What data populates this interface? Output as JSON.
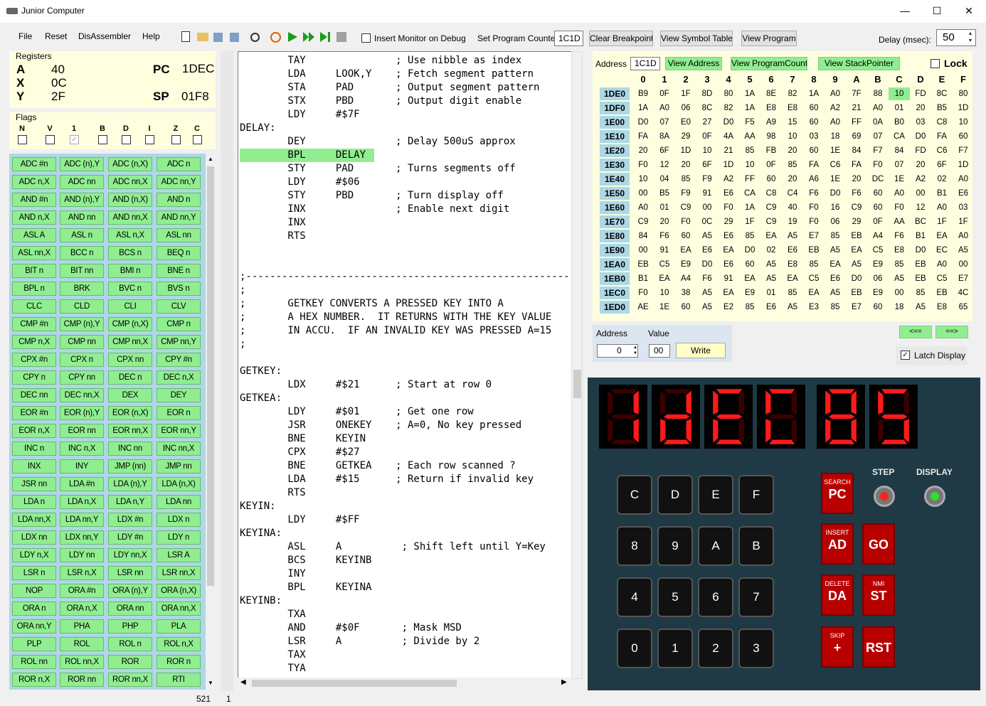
{
  "window": {
    "title": "Junior Computer",
    "min": "—",
    "max": "☐",
    "close": "✕"
  },
  "menu": [
    "File",
    "Reset",
    "DisAssembler",
    "Help"
  ],
  "toolbar": {
    "insert_monitor": "Insert Monitor on Debug",
    "set_pc_label": "Set Program Counter",
    "set_pc_value": "1C1D",
    "clear_breakpoint": "Clear Breakpoint",
    "view_symbol_table": "View Symbol Table",
    "view_program": "View Program",
    "delay_label": "Delay (msec):",
    "delay_value": "50"
  },
  "registers": {
    "title": "Registers",
    "A": "40",
    "X": "0C",
    "Y": "2F",
    "PC": "1DEC",
    "SP": "01F8"
  },
  "flags": {
    "title": "Flags",
    "names": [
      "N",
      "V",
      "1",
      "B",
      "D",
      "I",
      "Z",
      "C"
    ]
  },
  "opcodes": [
    "ADC #n",
    "ADC (n),Y",
    "ADC (n,X)",
    "ADC n",
    "ADC n,X",
    "ADC nn",
    "ADC nn,X",
    "ADC nn,Y",
    "AND #n",
    "AND (n),Y",
    "AND (n,X)",
    "AND n",
    "AND n,X",
    "AND nn",
    "AND nn,X",
    "AND nn,Y",
    "ASL A",
    "ASL n",
    "ASL n,X",
    "ASL nn",
    "ASL nn,X",
    "BCC n",
    "BCS n",
    "BEQ n",
    "BIT n",
    "BIT nn",
    "BMI n",
    "BNE n",
    "BPL n",
    "BRK",
    "BVC n",
    "BVS n",
    "CLC",
    "CLD",
    "CLI",
    "CLV",
    "CMP #n",
    "CMP (n),Y",
    "CMP (n,X)",
    "CMP n",
    "CMP n,X",
    "CMP nn",
    "CMP nn,X",
    "CMP nn,Y",
    "CPX #n",
    "CPX n",
    "CPX nn",
    "CPY #n",
    "CPY n",
    "CPY nn",
    "DEC n",
    "DEC n,X",
    "DEC nn",
    "DEC nn,X",
    "DEX",
    "DEY",
    "EOR #n",
    "EOR (n),Y",
    "EOR (n,X)",
    "EOR n",
    "EOR n,X",
    "EOR nn",
    "EOR nn,X",
    "EOR nn,Y",
    "INC n",
    "INC n,X",
    "INC nn",
    "INC nn,X",
    "INX",
    "INY",
    "JMP (nn)",
    "JMP nn",
    "JSR nn",
    "LDA #n",
    "LDA (n),Y",
    "LDA (n,X)",
    "LDA n",
    "LDA n,X",
    "LDA n,Y",
    "LDA nn",
    "LDA nn,X",
    "LDA nn,Y",
    "LDX #n",
    "LDX n",
    "LDX nn",
    "LDX nn,Y",
    "LDY #n",
    "LDY n",
    "LDY n,X",
    "LDY nn",
    "LDY nn,X",
    "LSR A",
    "LSR n",
    "LSR n,X",
    "LSR nn",
    "LSR nn,X",
    "NOP",
    "ORA #n",
    "ORA (n),Y",
    "ORA (n,X)",
    "ORA n",
    "ORA n,X",
    "ORA nn",
    "ORA nn,X",
    "ORA nn,Y",
    "PHA",
    "PHP",
    "PLA",
    "PLP",
    "ROL",
    "ROL n",
    "ROL n,X",
    "ROL nn",
    "ROL nn,X",
    "ROR",
    "ROR n",
    "ROR n,X",
    "ROR nn",
    "ROR nn,X",
    "RTI"
  ],
  "code_lines": [
    "        TAY               ; Use nibble as index",
    "        LDA     LOOK,Y    ; Fetch segment pattern",
    "        STA     PAD       ; Output segment pattern",
    "        STX     PBD       ; Output digit enable",
    "        LDY     #$7F",
    "DELAY:",
    "        DEY               ; Delay 500uS approx",
    "        BPL     DELAY",
    "        STY     PAD       ; Turns segments off",
    "        LDY     #$06",
    "        STY     PBD       ; Turn display off",
    "        INX               ; Enable next digit",
    "        INX",
    "        RTS",
    "",
    "",
    ";-------------------------------------------------------",
    ";",
    ";       GETKEY CONVERTS A PRESSED KEY INTO A",
    ";       A HEX NUMBER.  IT RETURNS WITH THE KEY VALUE",
    ";       IN ACCU.  IF AN INVALID KEY WAS PRESSED A=15",
    ";",
    "",
    "GETKEY:",
    "        LDX     #$21      ; Start at row 0",
    "GETKEA:",
    "        LDY     #$01      ; Get one row",
    "        JSR     ONEKEY    ; A=0, No key pressed",
    "        BNE     KEYIN",
    "        CPX     #$27",
    "        BNE     GETKEA    ; Each row scanned ?",
    "        LDA     #$15      ; Return if invalid key",
    "        RTS",
    "KEYIN:",
    "        LDY     #$FF",
    "KEYINA:",
    "        ASL     A          ; Shift left until Y=Key",
    "        BCS     KEYINB",
    "        INY",
    "        BPL     KEYINA",
    "KEYINB:",
    "        TXA",
    "        AND     #$0F       ; Mask MSD",
    "        LSR     A          ; Divide by 2",
    "        TAX",
    "        TYA"
  ],
  "memory": {
    "address_label": "Address",
    "address_value": "1C1D",
    "view_address": "View Address",
    "view_pc": "View ProgramCounter",
    "view_sp": "View StackPointer",
    "lock": "Lock",
    "columns": [
      "0",
      "1",
      "2",
      "3",
      "4",
      "5",
      "6",
      "7",
      "8",
      "9",
      "A",
      "B",
      "C",
      "D",
      "E",
      "F"
    ],
    "rows": [
      {
        "addr": "1DE0",
        "vals": [
          "B9",
          "0F",
          "1F",
          "8D",
          "80",
          "1A",
          "8E",
          "82",
          "1A",
          "A0",
          "7F",
          "88",
          "10",
          "FD",
          "8C",
          "80"
        ]
      },
      {
        "addr": "1DF0",
        "vals": [
          "1A",
          "A0",
          "06",
          "8C",
          "82",
          "1A",
          "E8",
          "E8",
          "60",
          "A2",
          "21",
          "A0",
          "01",
          "20",
          "B5",
          "1D"
        ]
      },
      {
        "addr": "1E00",
        "vals": [
          "D0",
          "07",
          "E0",
          "27",
          "D0",
          "F5",
          "A9",
          "15",
          "60",
          "A0",
          "FF",
          "0A",
          "B0",
          "03",
          "C8",
          "10"
        ]
      },
      {
        "addr": "1E10",
        "vals": [
          "FA",
          "8A",
          "29",
          "0F",
          "4A",
          "AA",
          "98",
          "10",
          "03",
          "18",
          "69",
          "07",
          "CA",
          "D0",
          "FA",
          "60"
        ]
      },
      {
        "addr": "1E20",
        "vals": [
          "20",
          "6F",
          "1D",
          "10",
          "21",
          "85",
          "FB",
          "20",
          "60",
          "1E",
          "84",
          "F7",
          "84",
          "FD",
          "C6",
          "F7"
        ]
      },
      {
        "addr": "1E30",
        "vals": [
          "F0",
          "12",
          "20",
          "6F",
          "1D",
          "10",
          "0F",
          "85",
          "FA",
          "C6",
          "FA",
          "F0",
          "07",
          "20",
          "6F",
          "1D"
        ]
      },
      {
        "addr": "1E40",
        "vals": [
          "10",
          "04",
          "85",
          "F9",
          "A2",
          "FF",
          "60",
          "20",
          "A6",
          "1E",
          "20",
          "DC",
          "1E",
          "A2",
          "02",
          "A0"
        ]
      },
      {
        "addr": "1E50",
        "vals": [
          "00",
          "B5",
          "F9",
          "91",
          "E6",
          "CA",
          "C8",
          "C4",
          "F6",
          "D0",
          "F6",
          "60",
          "A0",
          "00",
          "B1",
          "E6"
        ]
      },
      {
        "addr": "1E60",
        "vals": [
          "A0",
          "01",
          "C9",
          "00",
          "F0",
          "1A",
          "C9",
          "40",
          "F0",
          "16",
          "C9",
          "60",
          "F0",
          "12",
          "A0",
          "03"
        ]
      },
      {
        "addr": "1E70",
        "vals": [
          "C9",
          "20",
          "F0",
          "0C",
          "29",
          "1F",
          "C9",
          "19",
          "F0",
          "06",
          "29",
          "0F",
          "AA",
          "BC",
          "1F",
          "1F"
        ]
      },
      {
        "addr": "1E80",
        "vals": [
          "84",
          "F6",
          "60",
          "A5",
          "E6",
          "85",
          "EA",
          "A5",
          "E7",
          "85",
          "EB",
          "A4",
          "F6",
          "B1",
          "EA",
          "A0"
        ]
      },
      {
        "addr": "1E90",
        "vals": [
          "00",
          "91",
          "EA",
          "E6",
          "EA",
          "D0",
          "02",
          "E6",
          "EB",
          "A5",
          "EA",
          "C5",
          "E8",
          "D0",
          "EC",
          "A5"
        ]
      },
      {
        "addr": "1EA0",
        "vals": [
          "EB",
          "C5",
          "E9",
          "D0",
          "E6",
          "60",
          "A5",
          "E8",
          "85",
          "EA",
          "A5",
          "E9",
          "85",
          "EB",
          "A0",
          "00"
        ]
      },
      {
        "addr": "1EB0",
        "vals": [
          "B1",
          "EA",
          "A4",
          "F6",
          "91",
          "EA",
          "A5",
          "EA",
          "C5",
          "E6",
          "D0",
          "06",
          "A5",
          "EB",
          "C5",
          "E7"
        ]
      },
      {
        "addr": "1EC0",
        "vals": [
          "F0",
          "10",
          "38",
          "A5",
          "EA",
          "E9",
          "01",
          "85",
          "EA",
          "A5",
          "EB",
          "E9",
          "00",
          "85",
          "EB",
          "4C"
        ]
      },
      {
        "addr": "1ED0",
        "vals": [
          "AE",
          "1E",
          "60",
          "A5",
          "E2",
          "85",
          "E6",
          "A5",
          "E3",
          "85",
          "E7",
          "60",
          "18",
          "A5",
          "E8",
          "65"
        ]
      }
    ]
  },
  "write_panel": {
    "address_label": "Address",
    "value_label": "Value",
    "address_value": "0",
    "value_value": "00",
    "write": "Write"
  },
  "nav": {
    "back": "<==",
    "fwd": "==>",
    "latch": "Latch Display"
  },
  "board": {
    "digits": [
      "1",
      "D",
      "E",
      "C",
      "8",
      "5"
    ],
    "hex_keys": [
      "C",
      "D",
      "E",
      "F",
      "8",
      "9",
      "A",
      "B",
      "4",
      "5",
      "6",
      "7",
      "0",
      "1",
      "2",
      "3"
    ],
    "func_keys": [
      {
        "small": "SEARCH",
        "big": "PC"
      },
      {
        "small": "INSERT",
        "big": "AD"
      },
      {
        "small": "",
        "big": "GO"
      },
      {
        "small": "DELETE",
        "big": "DA"
      },
      {
        "small": "NMI",
        "big": "ST"
      },
      {
        "small": "SKIP",
        "big": "+"
      },
      {
        "small": "",
        "big": "RST"
      }
    ],
    "step_label": "STEP",
    "display_label": "DISPLAY"
  },
  "statusbar": {
    "left": "521",
    "right": "1"
  },
  "colors": {
    "green": "#90ee90",
    "yellow": "#ffffe0",
    "blue": "#add8e6",
    "red": "#b80000"
  }
}
